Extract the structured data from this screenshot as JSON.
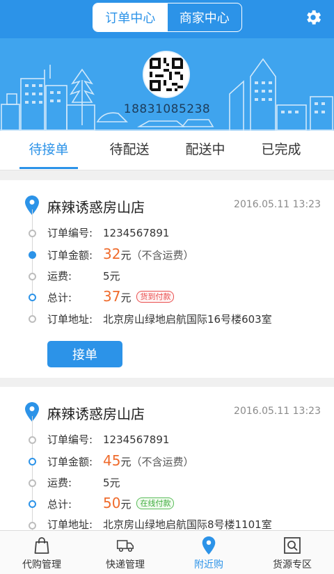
{
  "header": {
    "segments": [
      {
        "label": "订单中心",
        "active": true
      },
      {
        "label": "商家中心",
        "active": false
      }
    ],
    "settings_icon": "gear-icon"
  },
  "banner": {
    "phone": "18831085238",
    "qr_icon": "qr-code-avatar"
  },
  "tabs": [
    {
      "label": "待接单",
      "active": true
    },
    {
      "label": "待配送",
      "active": false
    },
    {
      "label": "配送中",
      "active": false
    },
    {
      "label": "已完成",
      "active": false
    }
  ],
  "orders": [
    {
      "shop": "麻辣诱惑房山店",
      "time": "2016.05.11 13:23",
      "order_no_label": "订单编号:",
      "order_no": "1234567891",
      "amount_label": "订单金额:",
      "amount": "32",
      "amount_unit": "元",
      "amount_note": "（不含运费）",
      "fee_label": "运费:",
      "fee": "5元",
      "total_label": "总计:",
      "total": "37",
      "total_unit": "元",
      "badge": "货到付款",
      "badge_color": "#e94f4f",
      "address_label": "订单地址:",
      "address": "北京房山绿地启航国际16号楼603室",
      "action_label": "接单"
    },
    {
      "shop": "麻辣诱惑房山店",
      "time": "2016.05.11 13:23",
      "order_no_label": "订单编号:",
      "order_no": "1234567891",
      "amount_label": "订单金额:",
      "amount": "45",
      "amount_unit": "元",
      "amount_note": "（不含运费）",
      "fee_label": "运费:",
      "fee": "5元",
      "total_label": "总计:",
      "total": "50",
      "total_unit": "元",
      "badge": "在线付款",
      "badge_color": "#3fae3f",
      "address_label": "订单地址:",
      "address": "北京房山绿地启航国际8号楼1101室"
    }
  ],
  "bottom_nav": [
    {
      "label": "代购管理",
      "icon": "shopping-bag-icon",
      "active": false
    },
    {
      "label": "快递管理",
      "icon": "delivery-truck-icon",
      "active": false
    },
    {
      "label": "附近购",
      "icon": "location-pin-icon",
      "active": true
    },
    {
      "label": "货源专区",
      "icon": "search-box-icon",
      "active": false
    }
  ],
  "colors": {
    "primary": "#2c93e8",
    "price": "#ef6b2c",
    "banner": "#3fa4ee"
  }
}
